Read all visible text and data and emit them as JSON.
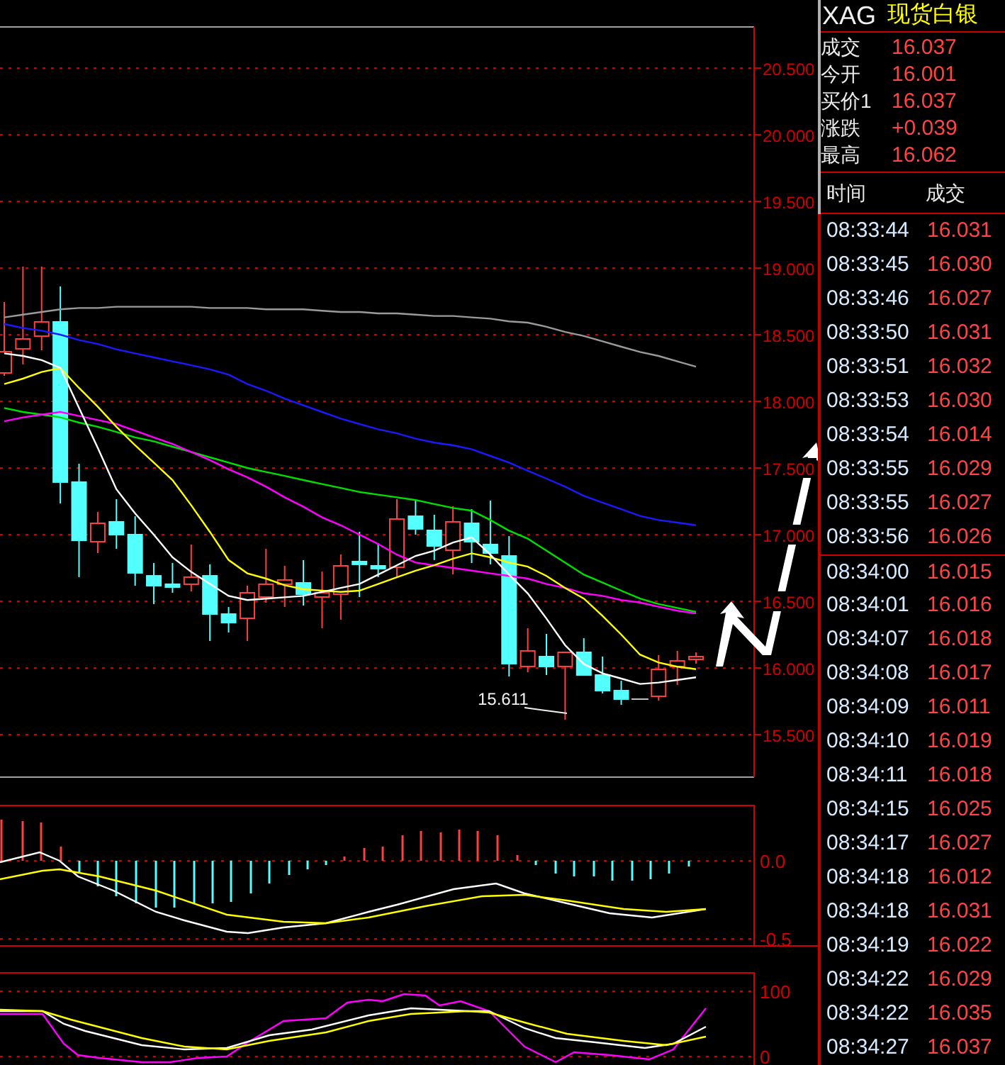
{
  "instrument": {
    "code": "XAG",
    "name": "现货白银"
  },
  "quote": [
    {
      "label": "成交",
      "value": "16.037"
    },
    {
      "label": "今开",
      "value": "16.001"
    },
    {
      "label": "买价1",
      "value": "16.037"
    },
    {
      "label": "涨跌",
      "value": "+0.039"
    },
    {
      "label": "最高",
      "value": "16.062"
    }
  ],
  "ticks_header": {
    "time": "时间",
    "price": "成交"
  },
  "ticks": [
    {
      "time": "08:33:44",
      "price": "16.031"
    },
    {
      "time": "08:33:45",
      "price": "16.030"
    },
    {
      "time": "08:33:46",
      "price": "16.027"
    },
    {
      "time": "08:33:50",
      "price": "16.031"
    },
    {
      "time": "08:33:51",
      "price": "16.032"
    },
    {
      "time": "08:33:53",
      "price": "16.030"
    },
    {
      "time": "08:33:54",
      "price": "16.014"
    },
    {
      "time": "08:33:55",
      "price": "16.029"
    },
    {
      "time": "08:33:55",
      "price": "16.027"
    },
    {
      "time": "08:33:56",
      "price": "16.026"
    },
    {
      "time": "08:34:00",
      "price": "16.015"
    },
    {
      "time": "08:34:01",
      "price": "16.016"
    },
    {
      "time": "08:34:07",
      "price": "16.018"
    },
    {
      "time": "08:34:08",
      "price": "16.017"
    },
    {
      "time": "08:34:09",
      "price": "16.011"
    },
    {
      "time": "08:34:10",
      "price": "16.019"
    },
    {
      "time": "08:34:11",
      "price": "16.018"
    },
    {
      "time": "08:34:15",
      "price": "16.025"
    },
    {
      "time": "08:34:17",
      "price": "16.027"
    },
    {
      "time": "08:34:18",
      "price": "16.012"
    },
    {
      "time": "08:34:18",
      "price": "16.031"
    },
    {
      "time": "08:34:19",
      "price": "16.022"
    },
    {
      "time": "08:34:22",
      "price": "16.029"
    },
    {
      "time": "08:34:22",
      "price": "16.035"
    },
    {
      "time": "08:34:27",
      "price": "16.037"
    }
  ],
  "price_chart": {
    "chart_data": {
      "type": "candlestick",
      "grid": true,
      "ylim": [
        15.5,
        20.5
      ],
      "yticks": [
        {
          "value": 20.5,
          "label": "20.500"
        },
        {
          "value": 20,
          "label": "20.000"
        },
        {
          "value": 19.5,
          "label": "19.500"
        },
        {
          "value": 19,
          "label": "19.000"
        },
        {
          "value": 18.5,
          "label": "18.500"
        },
        {
          "value": 18,
          "label": "18.000"
        },
        {
          "value": 17.5,
          "label": "17.500"
        },
        {
          "value": 17,
          "label": "17.000"
        },
        {
          "value": 16.5,
          "label": "16.500"
        },
        {
          "value": 16,
          "label": "16.000"
        },
        {
          "value": 15.5,
          "label": "15.500"
        }
      ],
      "ohlc": [
        [
          18.213,
          18.745,
          18.191,
          18.372
        ],
        [
          18.394,
          19.011,
          18.277,
          18.468
        ],
        [
          18.489,
          19.011,
          18.383,
          18.596
        ],
        [
          18.596,
          18.862,
          17.234,
          17.394
        ],
        [
          17.394,
          17.532,
          16.681,
          16.957
        ],
        [
          16.947,
          17.17,
          16.862,
          17.085
        ],
        [
          17.096,
          17.266,
          16.894,
          17.0
        ],
        [
          17.0,
          17.138,
          16.617,
          16.713
        ],
        [
          16.691,
          16.787,
          16.479,
          16.617
        ],
        [
          16.628,
          16.787,
          16.564,
          16.606
        ],
        [
          16.628,
          16.926,
          16.574,
          16.681
        ],
        [
          16.691,
          16.777,
          16.202,
          16.404
        ],
        [
          16.404,
          16.457,
          16.266,
          16.34
        ],
        [
          16.372,
          16.617,
          16.202,
          16.564
        ],
        [
          16.532,
          16.894,
          16.489,
          16.628
        ],
        [
          16.628,
          16.766,
          16.457,
          16.66
        ],
        [
          16.638,
          16.809,
          16.468,
          16.553
        ],
        [
          16.532,
          16.723,
          16.298,
          16.564
        ],
        [
          16.553,
          16.851,
          16.362,
          16.766
        ],
        [
          16.798,
          17.021,
          16.532,
          16.777
        ],
        [
          16.766,
          16.936,
          16.681,
          16.745
        ],
        [
          16.755,
          17.266,
          16.681,
          17.117
        ],
        [
          17.138,
          17.255,
          17.0,
          17.043
        ],
        [
          17.032,
          17.149,
          16.809,
          16.915
        ],
        [
          16.883,
          17.213,
          16.702,
          17.096
        ],
        [
          17.085,
          17.191,
          16.787,
          16.947
        ],
        [
          16.926,
          17.255,
          16.777,
          16.862
        ],
        [
          16.84,
          16.989,
          15.936,
          16.032
        ],
        [
          16.011,
          16.298,
          15.968,
          16.128
        ],
        [
          16.085,
          16.255,
          15.947,
          16.011
        ],
        [
          16.011,
          16.117,
          15.611,
          16.117
        ],
        [
          16.117,
          16.223,
          15.947,
          15.947
        ],
        [
          15.947,
          16.085,
          15.809,
          15.83
        ],
        [
          15.83,
          15.904,
          15.723,
          15.766
        ],
        [
          15.766,
          15.766,
          15.766,
          15.766
        ],
        [
          15.787,
          16.096,
          15.755,
          15.989
        ],
        [
          16.011,
          16.128,
          15.872,
          16.053
        ],
        [
          16.064,
          16.117,
          16.032,
          16.085
        ]
      ]
    },
    "moving_averages": {
      "chart_data": {
        "type": "line",
        "ylim": [
          15.5,
          20.5
        ],
        "series": [
          {
            "color": "#9a9a9a",
            "values": [
              18.63,
              18.65,
              18.67,
              18.69,
              18.7,
              18.7,
              18.71,
              18.71,
              18.71,
              18.71,
              18.71,
              18.7,
              18.7,
              18.7,
              18.69,
              18.69,
              18.69,
              18.68,
              18.67,
              18.67,
              18.66,
              18.66,
              18.65,
              18.64,
              18.64,
              18.63,
              18.62,
              18.6,
              18.59,
              18.56,
              18.52,
              18.49,
              18.45,
              18.41,
              18.37,
              18.34,
              18.3,
              18.26
            ]
          },
          {
            "color": "#1a1aff",
            "values": [
              18.58,
              18.55,
              18.53,
              18.5,
              18.46,
              18.43,
              18.39,
              18.36,
              18.33,
              18.3,
              18.27,
              18.24,
              18.2,
              18.13,
              18.08,
              18.02,
              17.97,
              17.92,
              17.87,
              17.83,
              17.79,
              17.76,
              17.72,
              17.69,
              17.67,
              17.64,
              17.59,
              17.54,
              17.48,
              17.42,
              17.36,
              17.29,
              17.24,
              17.19,
              17.14,
              17.11,
              17.09,
              17.07
            ]
          },
          {
            "color": "#00e000",
            "values": [
              17.95,
              17.92,
              17.9,
              17.88,
              17.84,
              17.81,
              17.77,
              17.73,
              17.7,
              17.66,
              17.62,
              17.58,
              17.54,
              17.5,
              17.47,
              17.44,
              17.41,
              17.38,
              17.35,
              17.32,
              17.3,
              17.28,
              17.26,
              17.23,
              17.2,
              17.18,
              17.11,
              17.03,
              16.97,
              16.88,
              16.79,
              16.7,
              16.64,
              16.58,
              16.52,
              16.48,
              16.45,
              16.42
            ]
          },
          {
            "color": "#ff00ff",
            "values": [
              17.85,
              17.88,
              17.9,
              17.92,
              17.89,
              17.86,
              17.83,
              17.78,
              17.73,
              17.68,
              17.62,
              17.56,
              17.49,
              17.43,
              17.36,
              17.28,
              17.21,
              17.13,
              17.07,
              17.0,
              16.93,
              16.85,
              16.79,
              16.77,
              16.75,
              16.73,
              16.71,
              16.69,
              16.67,
              16.63,
              16.6,
              16.56,
              16.54,
              16.51,
              16.49,
              16.46,
              16.43,
              16.41
            ]
          },
          {
            "color": "#ffff00",
            "values": [
              18.13,
              18.17,
              18.22,
              18.25,
              18.1,
              17.96,
              17.81,
              17.67,
              17.54,
              17.41,
              17.22,
              17.02,
              16.81,
              16.71,
              16.67,
              16.62,
              16.59,
              16.58,
              16.57,
              16.58,
              16.63,
              16.68,
              16.73,
              16.77,
              16.82,
              16.86,
              16.83,
              16.79,
              16.76,
              16.69,
              16.6,
              16.52,
              16.39,
              16.25,
              16.1,
              16.04,
              16.01,
              15.99
            ]
          },
          {
            "color": "#ffffff",
            "values": [
              18.36,
              18.34,
              18.31,
              18.25,
              17.95,
              17.65,
              17.34,
              17.16,
              17.0,
              16.83,
              16.72,
              16.63,
              16.54,
              16.51,
              16.52,
              16.53,
              16.54,
              16.57,
              16.6,
              16.63,
              16.7,
              16.77,
              16.84,
              16.88,
              16.94,
              16.98,
              16.85,
              16.7,
              16.56,
              16.37,
              16.17,
              16.03,
              15.96,
              15.92,
              15.88,
              15.89,
              15.91,
              15.93
            ]
          }
        ]
      }
    },
    "low_label": "15.611"
  },
  "macd_chart": {
    "axis_labels": [
      "0.0",
      "-0.5"
    ]
  },
  "kdj_chart": {
    "axis_labels": [
      "100",
      "0"
    ]
  }
}
